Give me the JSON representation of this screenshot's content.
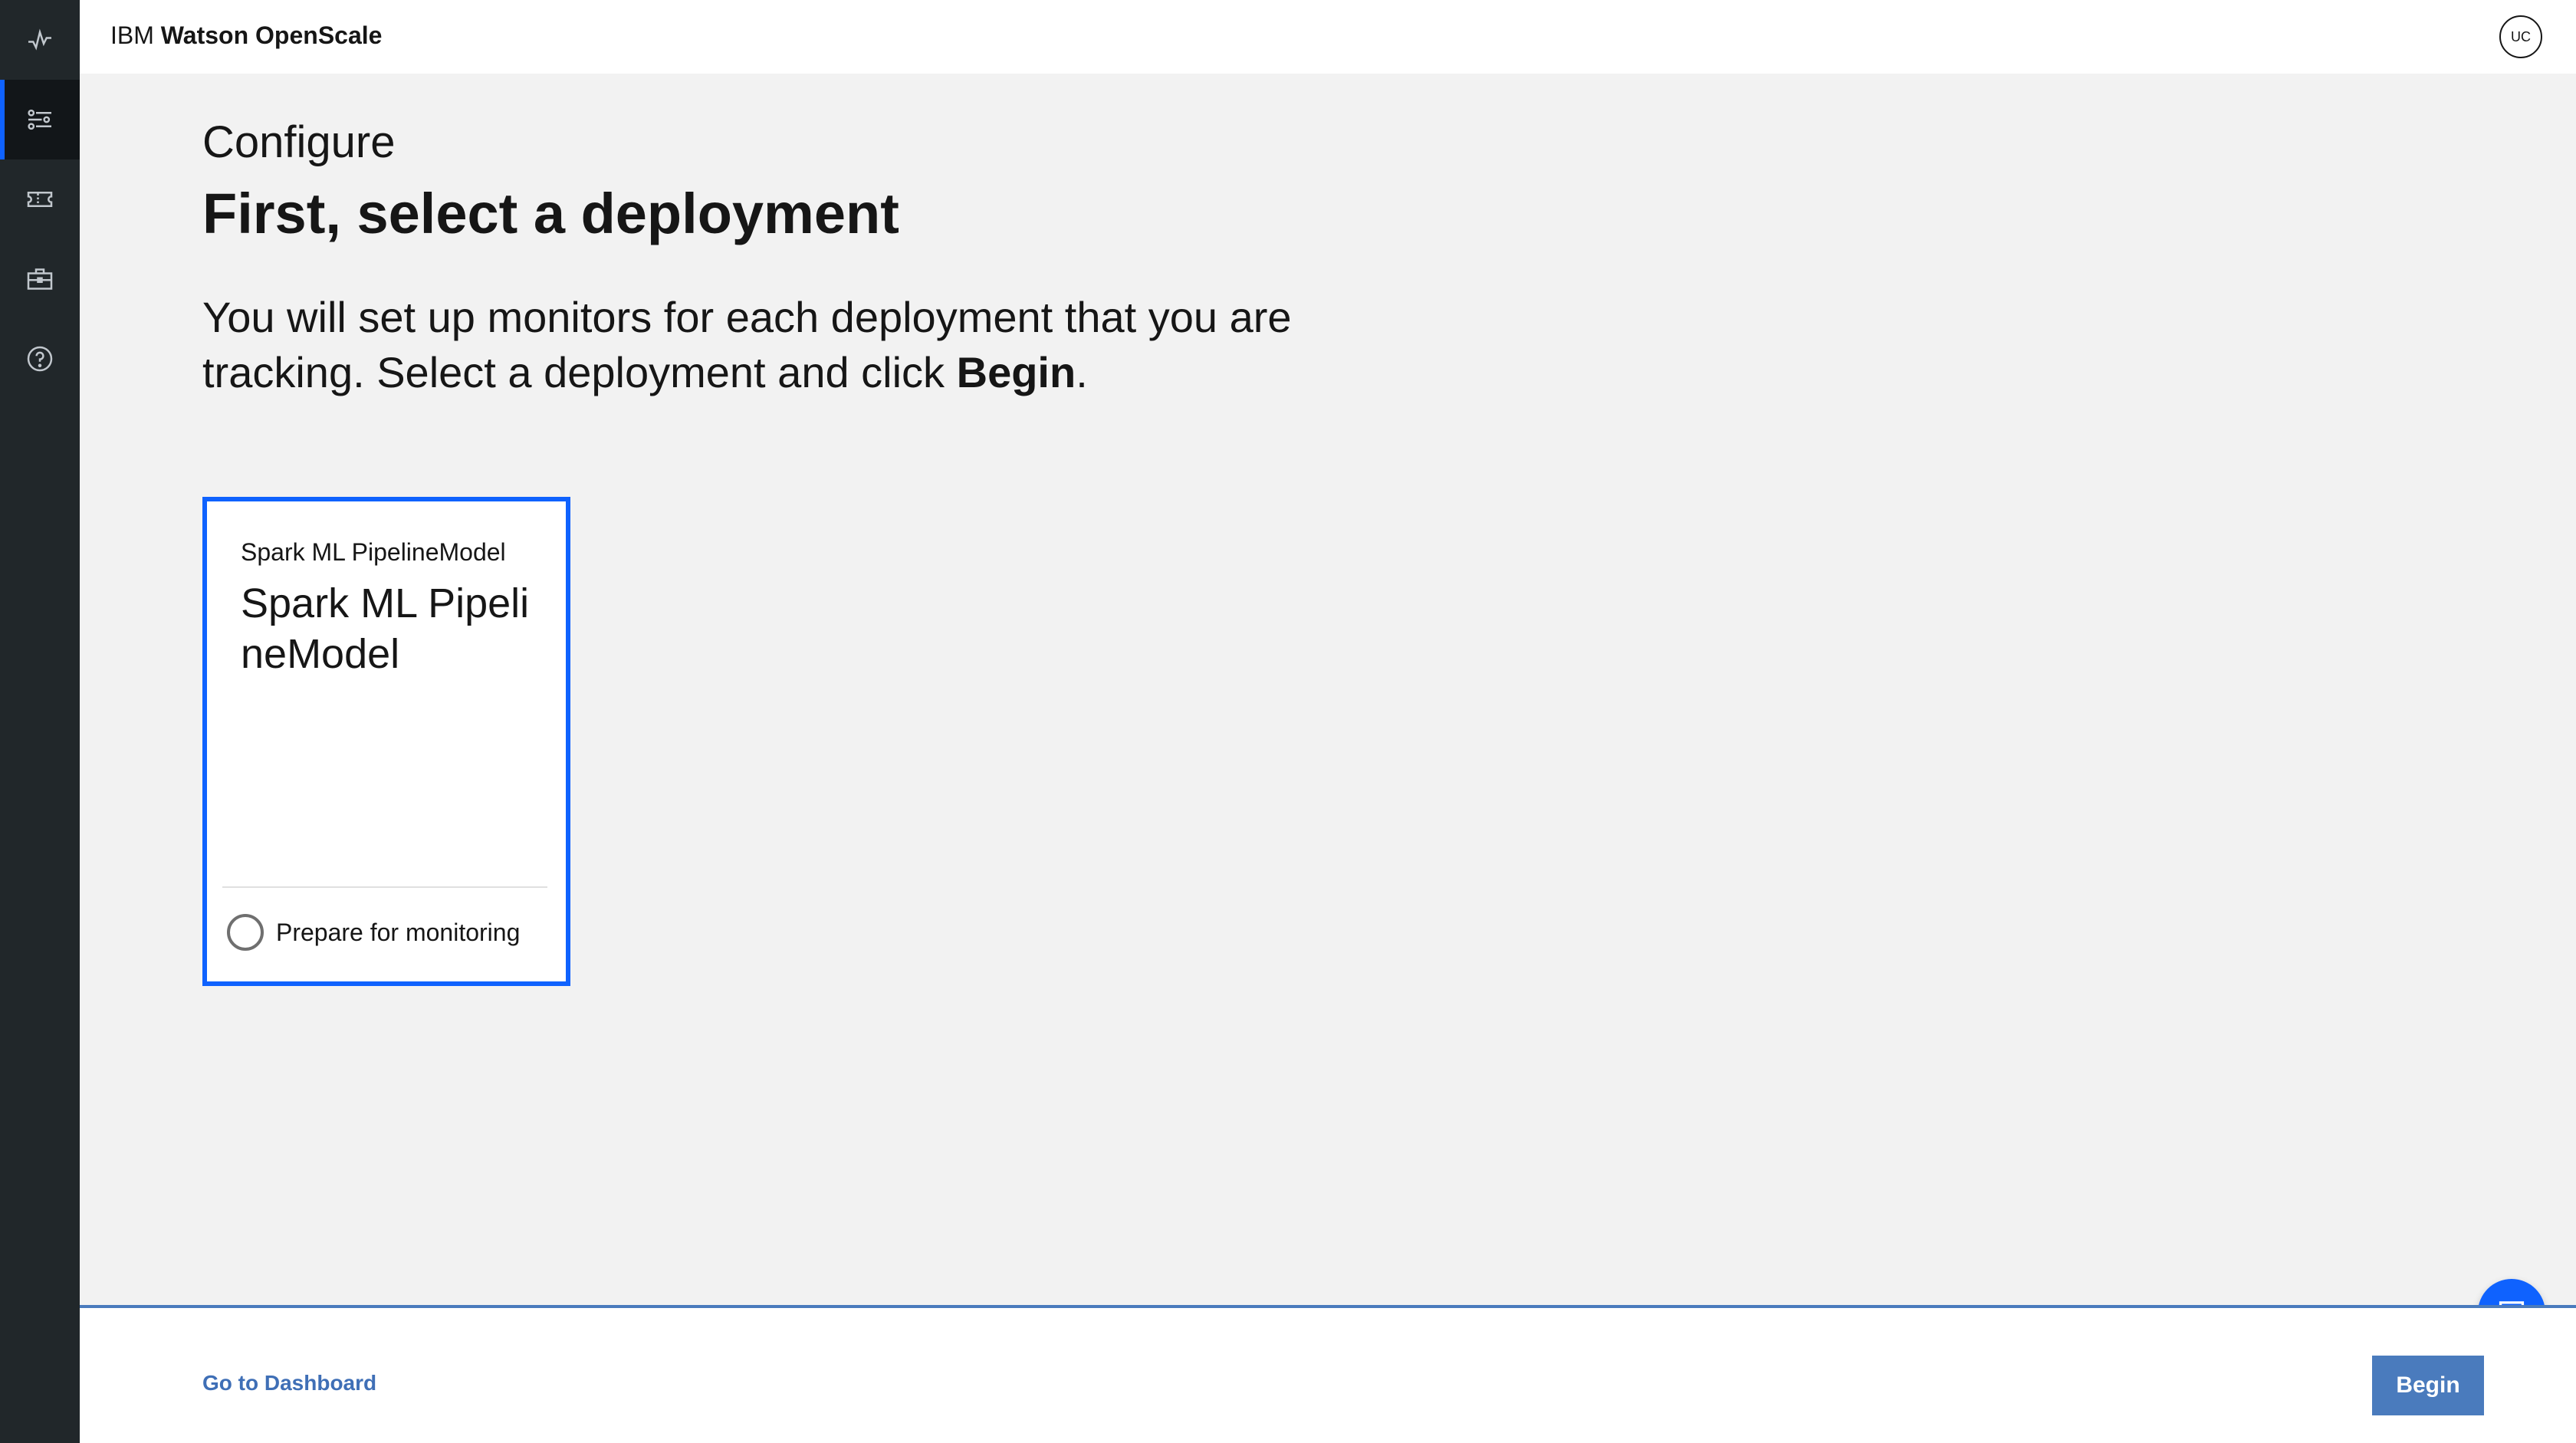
{
  "header": {
    "brand_prefix": "IBM",
    "brand_name": "Watson OpenScale",
    "avatar_initials": "UC"
  },
  "sidebar": {
    "items": [
      {
        "icon": "activity-icon"
      },
      {
        "icon": "sliders-icon",
        "active": true
      },
      {
        "icon": "ticket-icon"
      },
      {
        "icon": "briefcase-icon"
      },
      {
        "icon": "help-icon"
      }
    ]
  },
  "main": {
    "eyebrow": "Configure",
    "title": "First, select a deployment",
    "intro_text": "You will set up monitors for each deployment that you are tracking. Select a deployment and click",
    "intro_bold": "Begin",
    "intro_end": "."
  },
  "card": {
    "subtitle": "Spark ML PipelineModel",
    "title": "Spark ML PipelineModel",
    "radio_label": "Prepare for monitoring"
  },
  "footer": {
    "dashboard_link": "Go to Dashboard",
    "begin_label": "Begin"
  },
  "colors": {
    "accent": "#0f62fe",
    "button": "#4a7bbd",
    "rail": "#21272a"
  }
}
